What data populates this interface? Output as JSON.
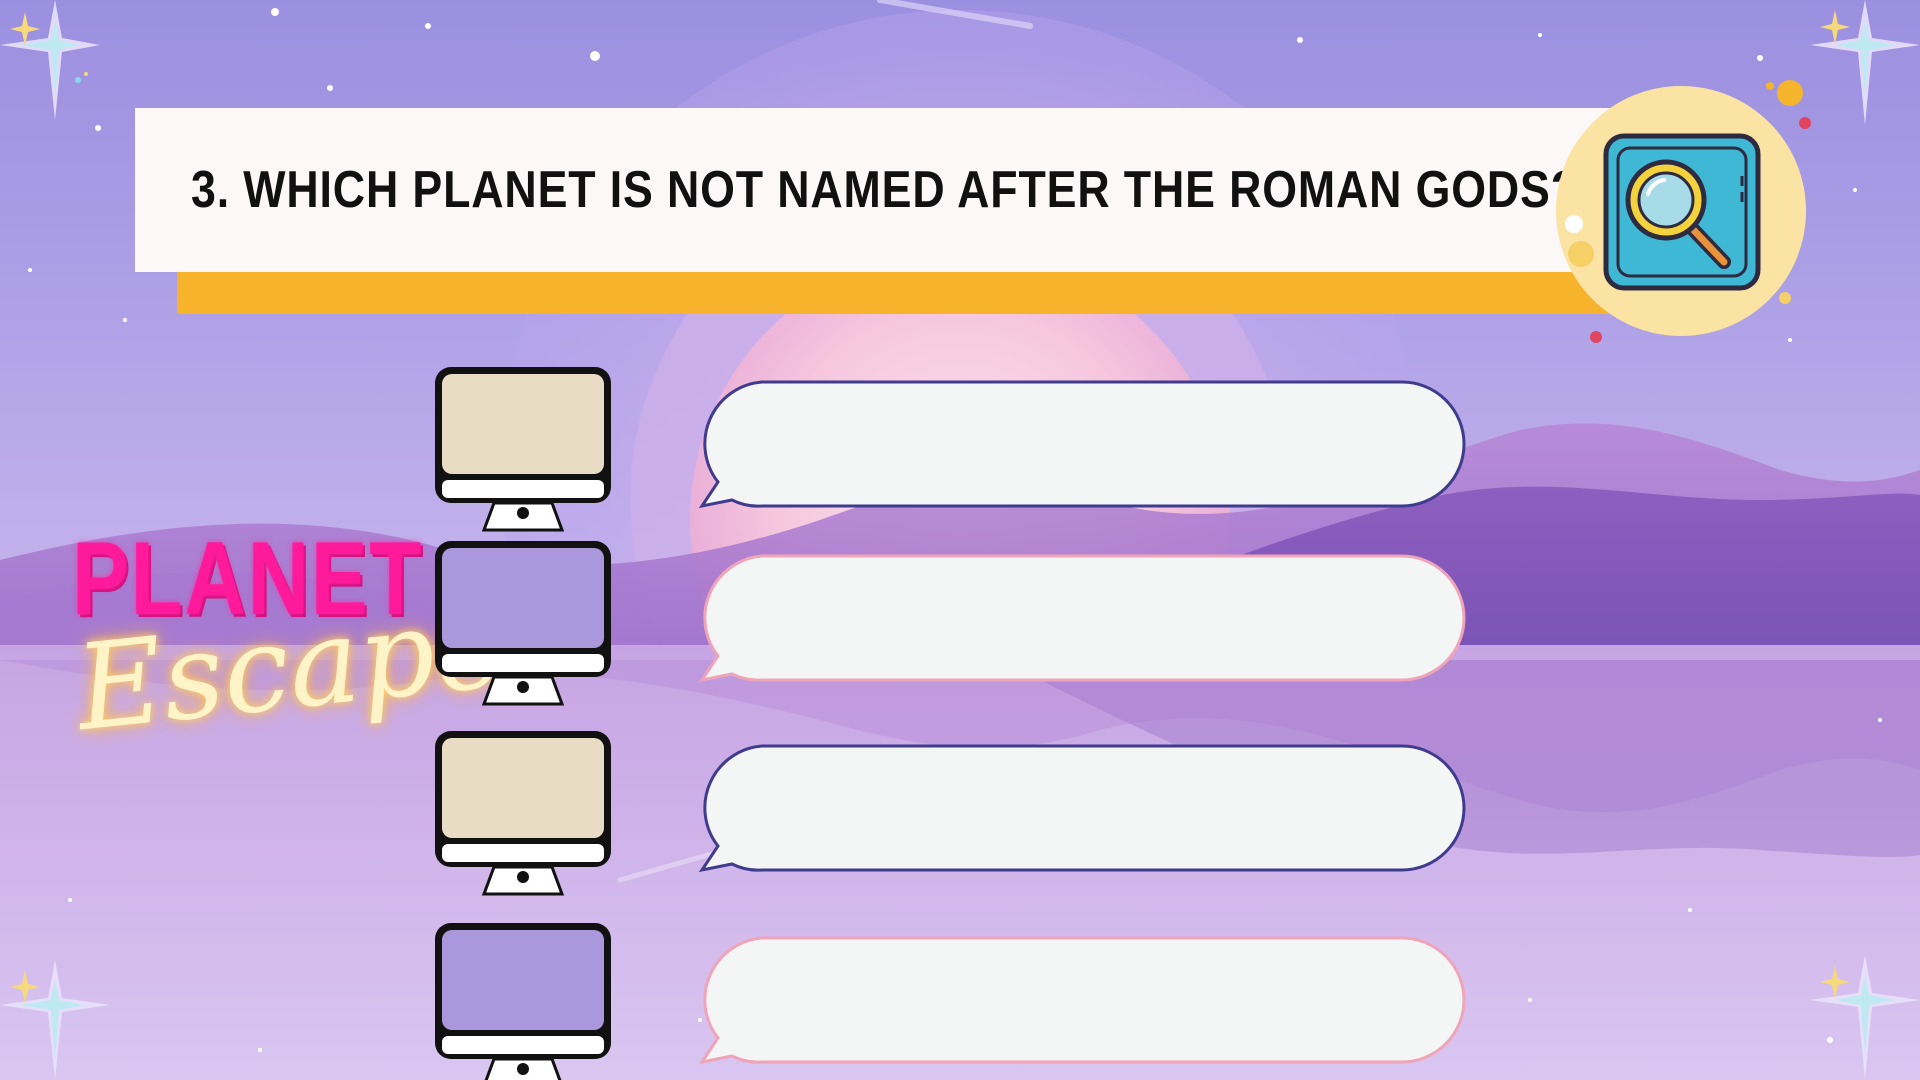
{
  "question": {
    "text": "3. Which planet is not named after the Roman gods?"
  },
  "logo": {
    "line1": "PLANET",
    "line2": "Escape"
  },
  "icons": {
    "search": "magnifying-glass-icon",
    "sparkle": "sparkle-star-icon",
    "monitor": "computer-monitor-icon"
  },
  "colors": {
    "background": "#a99ee4",
    "question_card": "#fdf8f8",
    "question_accent": "#f7b32b",
    "badge": "#fbe3a3",
    "search_icon_bg": "#3fb8d6",
    "logo_pink": "#ff1a9c",
    "logo_glow": "#ffd36b",
    "monitor_beige": "#e9dcc5",
    "monitor_purple": "#aa97dc",
    "bubble_fill": "#f4f5f5",
    "bubble_border_navy": "#3f3c8e",
    "bubble_border_pink": "#f0a4b8"
  },
  "options": [
    {
      "screen": "beige",
      "border": "navy",
      "text": ""
    },
    {
      "screen": "purple",
      "border": "pink",
      "text": ""
    },
    {
      "screen": "beige",
      "border": "navy",
      "text": ""
    },
    {
      "screen": "purple",
      "border": "pink",
      "text": ""
    }
  ]
}
